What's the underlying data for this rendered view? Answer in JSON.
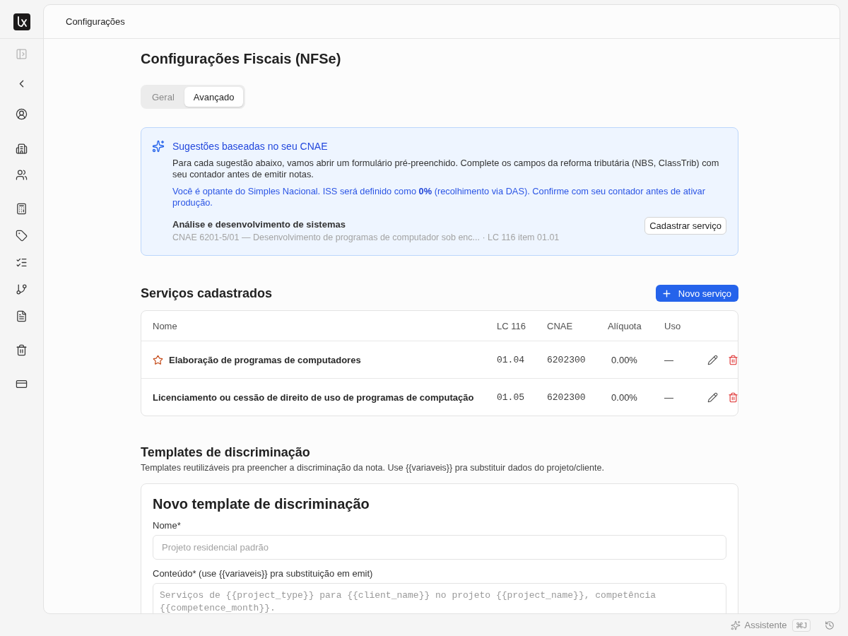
{
  "header": {
    "breadcrumb": "Configurações"
  },
  "page": {
    "title": "Configurações Fiscais (NFSe)"
  },
  "tabs": [
    {
      "label": "Geral",
      "selected": false
    },
    {
      "label": "Avançado",
      "selected": true
    }
  ],
  "suggestions": {
    "title": "Sugestões baseadas no seu CNAE",
    "description": "Para cada sugestão abaixo, vamos abrir um formulário pré-preenchido. Complete os campos da reforma tributária (NBS, ClassTrib) com seu contador antes de emitir notas.",
    "notice": "Você é optante do Simples Nacional. ISS será definido como **0%** (recolhimento via DAS). Confirme com seu contador antes de ativar produção.",
    "items": [
      {
        "name": "Análise e desenvolvimento de sistemas",
        "detail": "CNAE 6201-5/01 — Desenvolvimento de programas de computador sob enc... · LC 116 item 01.01",
        "action": "Cadastrar serviço"
      }
    ]
  },
  "services": {
    "title": "Serviços cadastrados",
    "new_button": "Novo serviço",
    "columns": [
      "Nome",
      "LC 116",
      "CNAE",
      "Alíquota",
      "Uso"
    ],
    "rows": [
      {
        "name": "Elaboração de programas de computadores",
        "starred": true,
        "lc116": "01.04",
        "cnae": "6202300",
        "aliquota": "0.00%",
        "uso": "—"
      },
      {
        "name": "Licenciamento ou cessão de direito de uso de programas de computação",
        "starred": false,
        "lc116": "01.05",
        "cnae": "6202300",
        "aliquota": "0.00%",
        "uso": "—"
      }
    ]
  },
  "templates": {
    "title": "Templates de discriminação",
    "description": "Templates reutilizáveis pra preencher a discriminação da nota. Use {{variaveis}} pra substituir dados do projeto/cliente.",
    "form": {
      "title": "Novo template de discriminação",
      "fields": [
        {
          "kind": "input",
          "label": "Nome*",
          "placeholder": "Projeto residencial padrão"
        },
        {
          "kind": "textarea",
          "label": "Conteúdo* (use {{variaveis}} pra substituição em emit)",
          "placeholder": "Serviços de {{project_type}} para {{client_name}} no projeto {{project_name}}, competência {{competence_month}}."
        }
      ]
    }
  },
  "footer": {
    "assistant": "Assistente",
    "shortcut": "⌘J"
  }
}
